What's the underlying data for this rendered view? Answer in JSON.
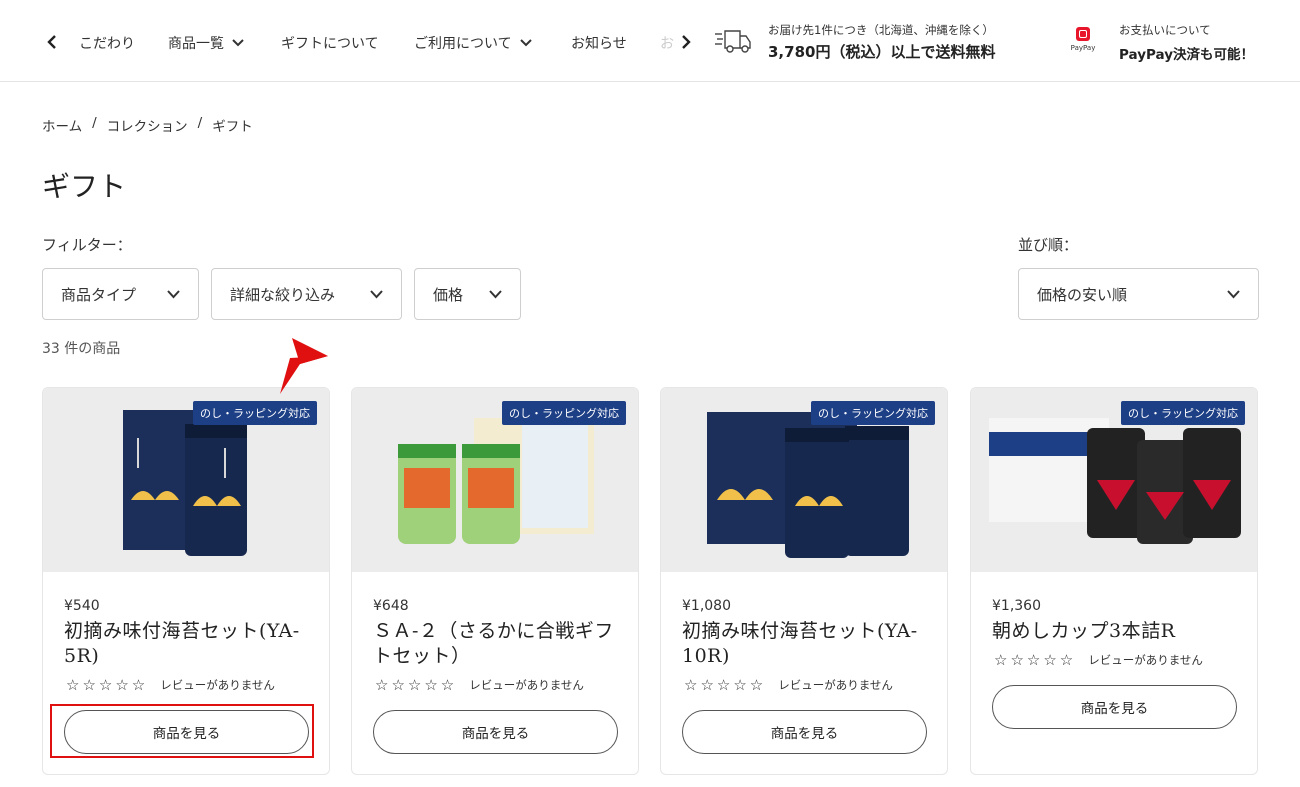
{
  "header": {
    "nav": {
      "items": [
        {
          "label": "こだわり"
        },
        {
          "label": "商品一覧"
        },
        {
          "label": "ギフトについて"
        },
        {
          "label": "ご利用について"
        },
        {
          "label": "お知らせ"
        }
      ],
      "cut_text": "お"
    },
    "shipping": {
      "small": "お届け先1件につき（北海道、沖縄を除く）",
      "big": "3,780円（税込）以上で送料無料",
      "icon": "truck-icon"
    },
    "payment": {
      "logo_text": "PayPay",
      "small": "お支払いについて",
      "big": "PayPay決済も可能！"
    }
  },
  "breadcrumb": {
    "home": "ホーム",
    "sep": "/",
    "collection": "コレクション",
    "current": "ギフト"
  },
  "page": {
    "title": "ギフト",
    "filter_label": "フィルター：",
    "sort_label": "並び順：",
    "filters": [
      {
        "label": "商品タイプ"
      },
      {
        "label": "詳細な絞り込み"
      },
      {
        "label": "価格"
      }
    ],
    "sort_value": "価格の安い順",
    "count": "33 件の商品"
  },
  "products": [
    {
      "badge": "のし・ラッピング対応",
      "price": "¥540",
      "name": "初摘み味付海苔セット(YA-5R)",
      "stars": "☆☆☆☆☆",
      "review": "レビューがありません",
      "button": "商品を見る"
    },
    {
      "badge": "のし・ラッピング対応",
      "price": "¥648",
      "name": "ＳＡ-２（さるかに合戦ギフトセット）",
      "stars": "☆☆☆☆☆",
      "review": "レビューがありません",
      "button": "商品を見る"
    },
    {
      "badge": "のし・ラッピング対応",
      "price": "¥1,080",
      "name": "初摘み味付海苔セット(YA-10R)",
      "stars": "☆☆☆☆☆",
      "review": "レビューがありません",
      "button": "商品を見る"
    },
    {
      "badge": "のし・ラッピング対応",
      "price": "¥1,360",
      "name": "朝めしカップ3本詰R",
      "stars": "☆☆☆☆☆",
      "review": "レビューがありません",
      "button": "商品を見る"
    }
  ],
  "colors": {
    "badge": "#1d3f86",
    "annotation": "#e01010",
    "paypay": "#e8162b"
  }
}
